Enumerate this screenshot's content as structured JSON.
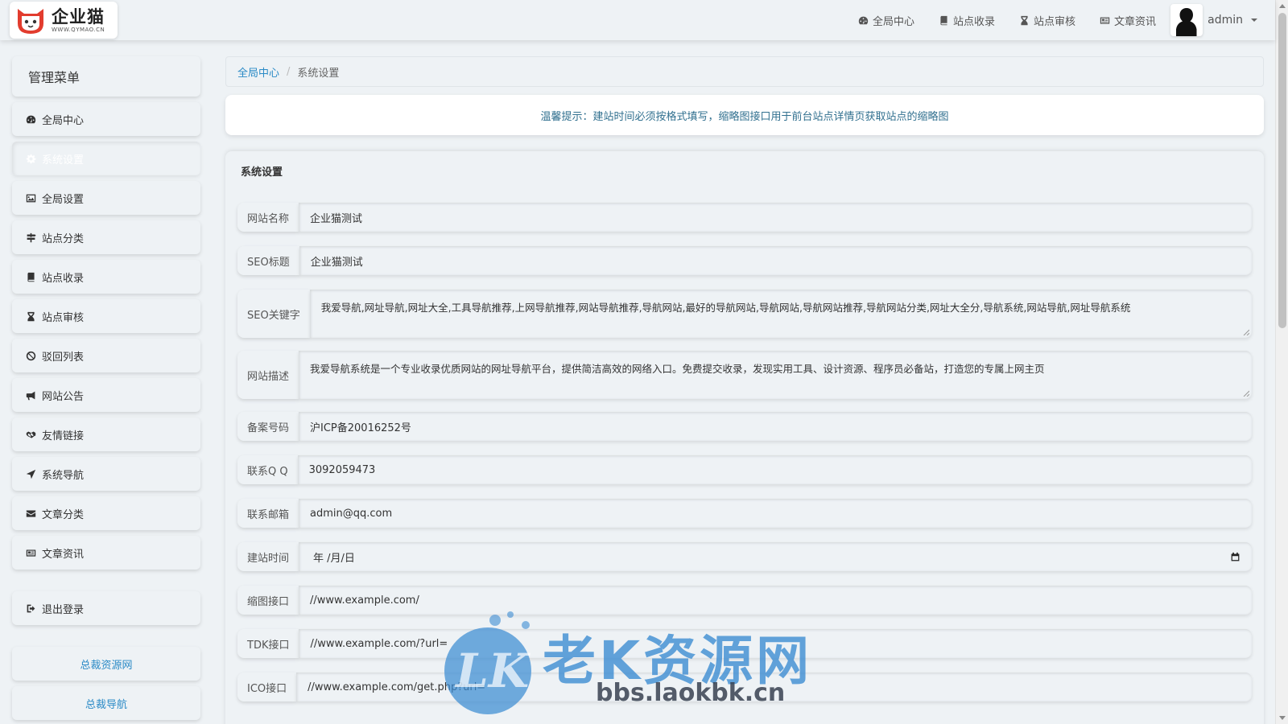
{
  "brand": {
    "name": "企业猫",
    "domain": "WWW.QYMAO.CN"
  },
  "topnav": [
    {
      "label": "全局中心",
      "icon": "dashboard-icon"
    },
    {
      "label": "站点收录",
      "icon": "book-icon"
    },
    {
      "label": "站点审核",
      "icon": "hourglass-icon"
    },
    {
      "label": "文章资讯",
      "icon": "newspaper-icon"
    }
  ],
  "user": {
    "name": "admin"
  },
  "sidebar": {
    "title": "管理菜单",
    "items": [
      {
        "label": "全局中心",
        "icon": "dashboard-icon"
      },
      {
        "label": "系统设置",
        "icon": "gear-icon",
        "active": true
      },
      {
        "label": "全局设置",
        "icon": "image-icon"
      },
      {
        "label": "站点分类",
        "icon": "signpost-icon"
      },
      {
        "label": "站点收录",
        "icon": "book-icon"
      },
      {
        "label": "站点审核",
        "icon": "hourglass-icon"
      },
      {
        "label": "驳回列表",
        "icon": "ban-icon"
      },
      {
        "label": "网站公告",
        "icon": "bullhorn-icon"
      },
      {
        "label": "友情链接",
        "icon": "handshake-icon"
      },
      {
        "label": "系统导航",
        "icon": "location-arrow-icon"
      },
      {
        "label": "文章分类",
        "icon": "envelope-icon"
      },
      {
        "label": "文章资讯",
        "icon": "newspaper-icon"
      }
    ],
    "logout": {
      "label": "退出登录",
      "icon": "sign-out-icon"
    },
    "links": [
      "总裁资源网",
      "总裁导航"
    ]
  },
  "breadcrumb": {
    "home": "全局中心",
    "separator": "/",
    "current": "系统设置"
  },
  "notice": "温馨提示：建站时间必须按格式填写，缩略图接口用于前台站点详情页获取站点的缩略图",
  "panel": {
    "title": "系统设置",
    "fields": {
      "site_name": {
        "label": "网站名称",
        "value": "企业猫测试"
      },
      "seo_title": {
        "label": "SEO标题",
        "value": "企业猫测试"
      },
      "seo_keywords": {
        "label": "SEO关键字",
        "value": "我爱导航,网址导航,网址大全,工具导航推荐,上网导航推荐,网站导航推荐,导航网站,最好的导航网站,导航网站,导航网站推荐,导航网站分类,网址大全分,导航系统,网站导航,网址导航系统"
      },
      "site_desc": {
        "label": "网站描述",
        "value": "我爱导航系统是一个专业收录优质网站的网址导航平台，提供简洁高效的网络入口。免费提交收录，发现实用工具、设计资源、程序员必备站，打造您的专属上网主页"
      },
      "icp": {
        "label": "备案号码",
        "value": "沪ICP备20016252号"
      },
      "qq": {
        "label": "联系Q Q",
        "value": "3092059473"
      },
      "email": {
        "label": "联系邮箱",
        "value": "admin@qq.com"
      },
      "build_date": {
        "label": "建站时间",
        "value": "年 /月/日"
      },
      "thumb_api": {
        "label": "缩图接口",
        "value": "//www.example.com/"
      },
      "tdk_api": {
        "label": "TDK接口",
        "value": "//www.example.com/?url="
      },
      "ico_api": {
        "label": "ICO接口",
        "value": "//www.example.com/get.php?url="
      }
    }
  },
  "watermark": {
    "title": "老K资源网",
    "url": "bbs.laokbk.cn",
    "badge": "LK"
  }
}
